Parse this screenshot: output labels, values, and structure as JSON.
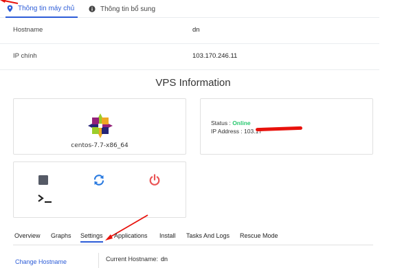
{
  "top_tabs": {
    "server_info": "Thông tin máy chủ",
    "extra_info": "Thông tin bổ sung"
  },
  "info": [
    {
      "label": "Hostname",
      "value": "dn"
    },
    {
      "label": "IP chính",
      "value": "103.170.246.11"
    }
  ],
  "vps_title": "VPS Information",
  "os_name": "centos-7.7-x86_64",
  "status": {
    "status_label": "Status : ",
    "status_value": "Online",
    "ip_label": "IP Address : ",
    "ip_value": "103.17"
  },
  "sub_tabs": [
    "Overview",
    "Graphs",
    "Settings",
    "Applications",
    "Install",
    "Tasks And Logs",
    "Rescue Mode"
  ],
  "bottom": {
    "link": "Change Hostname",
    "current_label": "Current Hostname:",
    "current_value": "dn"
  },
  "colors": {
    "accent": "#2b5bd7",
    "online": "#28c76f",
    "power": "#ea5455",
    "annotation": "#e8120c"
  },
  "icons": [
    "map-pin-icon",
    "info-icon",
    "centos-logo",
    "stop-icon",
    "restart-icon",
    "power-icon",
    "console-icon"
  ]
}
